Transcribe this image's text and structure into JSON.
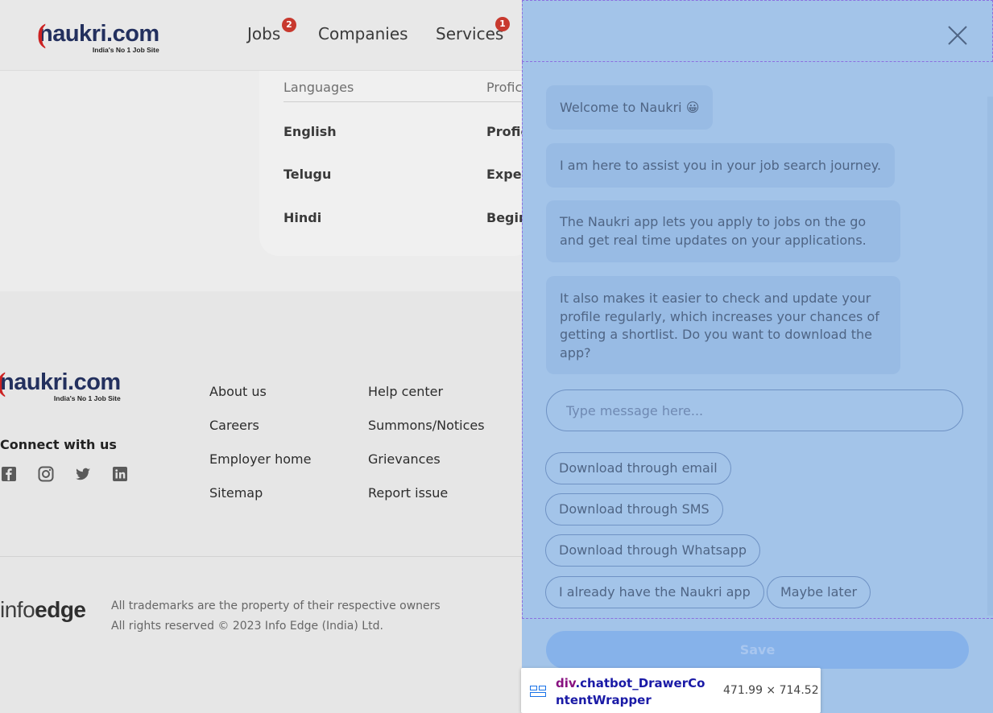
{
  "header": {
    "logo": {
      "word": "naukri",
      "dotcom": ".com",
      "tagline": "India's No 1 Job Site"
    },
    "nav": [
      {
        "label": "Jobs",
        "badge": "2"
      },
      {
        "label": "Companies"
      },
      {
        "label": "Services",
        "badge": "1"
      }
    ]
  },
  "languages": {
    "header": [
      "Languages",
      "Profic"
    ],
    "rows": [
      {
        "language": "English",
        "proficiency": "Profic"
      },
      {
        "language": "Telugu",
        "proficiency": "Exper"
      },
      {
        "language": "Hindi",
        "proficiency": "Begin"
      }
    ]
  },
  "footer": {
    "logo": {
      "word": "naukri",
      "dotcom": ".com",
      "tagline": "India's No 1 Job Site"
    },
    "connect_label": "Connect with us",
    "social_icons": [
      "facebook-icon",
      "instagram-icon",
      "twitter-icon",
      "linkedin-icon"
    ],
    "col1": [
      "About us",
      "Careers",
      "Employer home",
      "Sitemap"
    ],
    "col2": [
      "Help center",
      "Summons/Notices",
      "Grievances",
      "Report issue"
    ],
    "infoedge": {
      "light": "info",
      "bold": "edge"
    },
    "legal": [
      "All trademarks are the property of their respective owners",
      "All rights reserved © 2023 Info Edge (India) Ltd."
    ]
  },
  "chatbot": {
    "messages": [
      "Welcome to Naukri 😀",
      "I am here to assist you in your job search journey.",
      "The Naukri app lets you apply to jobs on the go and get real time updates on your applications.",
      "It also makes it easier to check and update your profile regularly, which increases your chances of getting a shortlist. Do you want to download the app?"
    ],
    "input_placeholder": "Type message here...",
    "chips": [
      "Download through email",
      "Download through SMS",
      "Download through Whatsapp",
      "I already have the Naukri app",
      "Maybe later"
    ],
    "save_label": "Save"
  },
  "devtools_tooltip": {
    "tag": "div",
    "class_name": ".chatbot_DrawerContentWrapper",
    "size": "471.99 × 714.52"
  },
  "colors": {
    "drawer_bg": "#a3c4e9",
    "accent_outline": "#8b6fe0",
    "badge": "#c8392e",
    "brand_blue": "#23305e"
  }
}
